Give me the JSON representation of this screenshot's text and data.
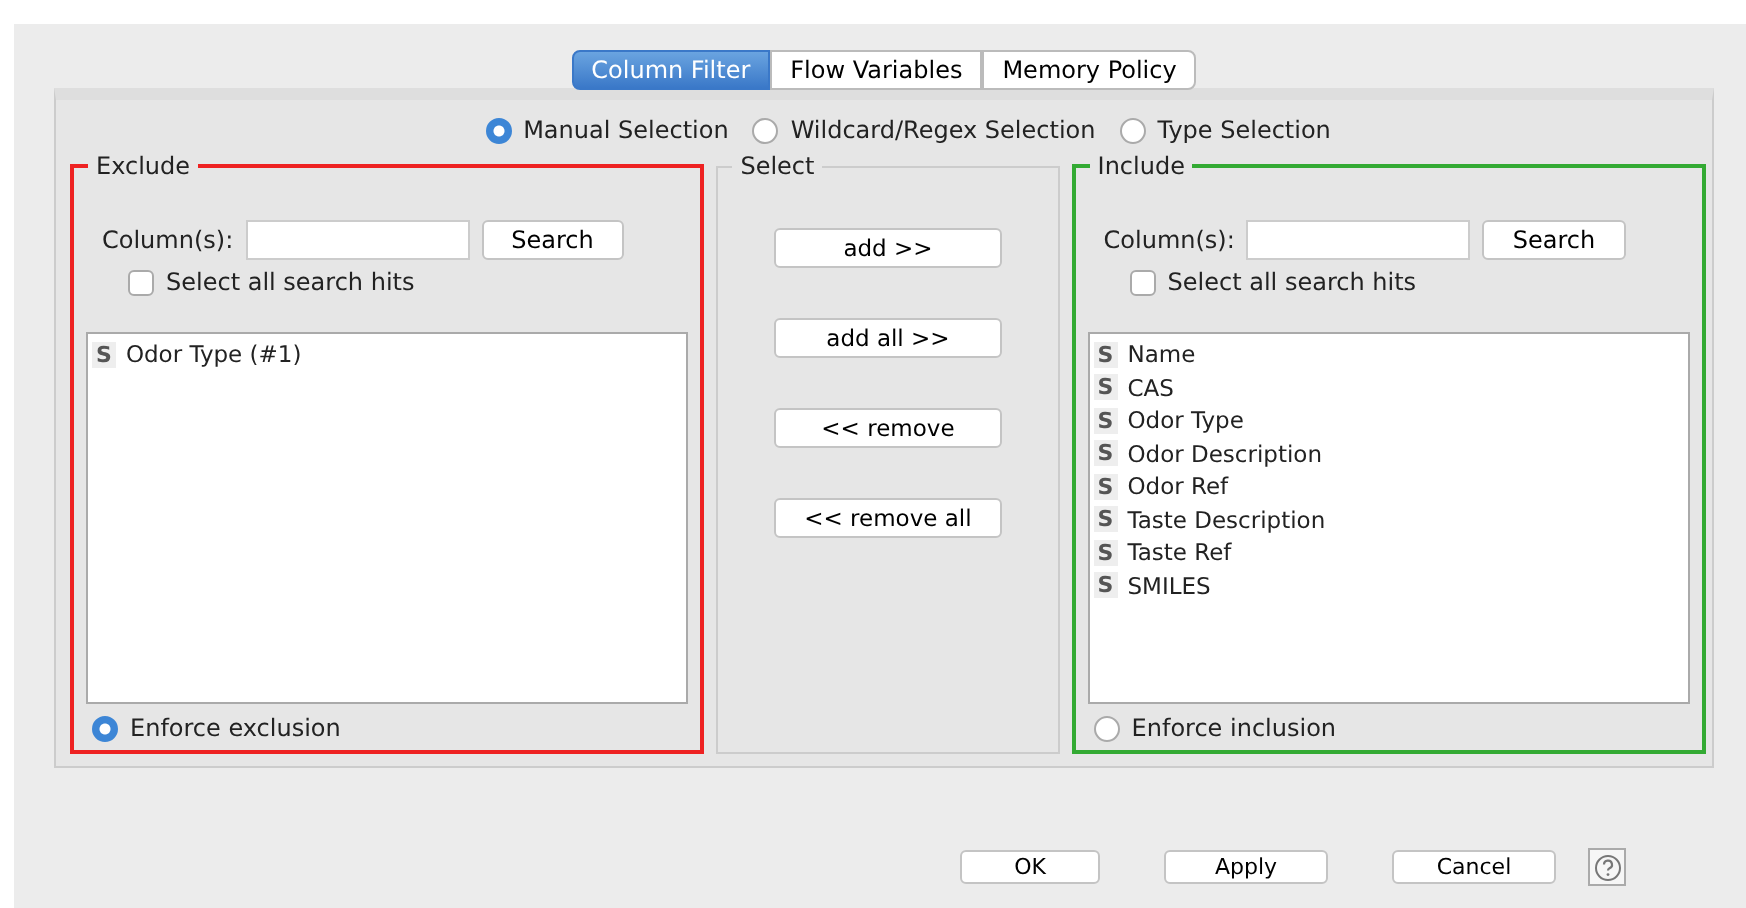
{
  "tabs": [
    {
      "label": "Column Filter",
      "selected": true
    },
    {
      "label": "Flow Variables",
      "selected": false
    },
    {
      "label": "Memory Policy",
      "selected": false
    }
  ],
  "modes": [
    {
      "label": "Manual Selection",
      "selected": true
    },
    {
      "label": "Wildcard/Regex Selection",
      "selected": false
    },
    {
      "label": "Type Selection",
      "selected": false
    }
  ],
  "exclude": {
    "title": "Exclude",
    "color": "#ee2222",
    "search_label": "Column(s):",
    "search_button": "Search",
    "select_hits": {
      "label": "Select all search hits",
      "checked": false
    },
    "columns": [
      {
        "type": "S",
        "name": "Odor Type (#1)"
      }
    ],
    "enforce": {
      "label": "Enforce exclusion",
      "selected": true
    }
  },
  "select": {
    "title": "Select",
    "buttons": [
      "add >>",
      "add all >>",
      "<< remove",
      "<< remove all"
    ]
  },
  "include": {
    "title": "Include",
    "color": "#33aa33",
    "search_label": "Column(s):",
    "search_button": "Search",
    "select_hits": {
      "label": "Select all search hits",
      "checked": false
    },
    "columns": [
      {
        "type": "S",
        "name": "Name"
      },
      {
        "type": "S",
        "name": "CAS"
      },
      {
        "type": "S",
        "name": "Odor Type"
      },
      {
        "type": "S",
        "name": "Odor Description"
      },
      {
        "type": "S",
        "name": "Odor Ref"
      },
      {
        "type": "S",
        "name": "Taste Description"
      },
      {
        "type": "S",
        "name": "Taste Ref"
      },
      {
        "type": "S",
        "name": "SMILES"
      }
    ],
    "enforce": {
      "label": "Enforce inclusion",
      "selected": false
    }
  },
  "footer_buttons": [
    "OK",
    "Apply",
    "Cancel"
  ]
}
